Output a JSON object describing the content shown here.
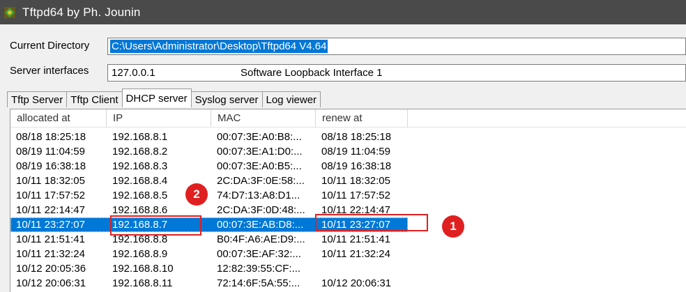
{
  "window": {
    "title": "Tftpd64 by Ph. Jounin",
    "icon": "app-icon"
  },
  "form": {
    "current_directory_label": "Current Directory",
    "current_directory_value": "C:\\Users\\Administrator\\Desktop\\Tftpd64 V4.64",
    "server_interfaces_label": "Server interfaces",
    "server_interface_ip": "127.0.0.1",
    "server_interface_name": "Software Loopback Interface 1"
  },
  "tabs": [
    {
      "label": "Tftp Server"
    },
    {
      "label": "Tftp Client"
    },
    {
      "label": "DHCP server",
      "active": true
    },
    {
      "label": "Syslog server"
    },
    {
      "label": "Log viewer"
    }
  ],
  "table": {
    "columns": [
      "allocated at",
      "IP",
      "MAC",
      "renew at"
    ],
    "rows": [
      [
        "08/18 18:25:18",
        "192.168.8.1",
        "00:07:3E:A0:B8:...",
        "08/18 18:25:18"
      ],
      [
        "08/19 11:04:59",
        "192.168.8.2",
        "00:07:3E:A1:D0:...",
        "08/19 11:04:59"
      ],
      [
        "08/19 16:38:18",
        "192.168.8.3",
        "00:07:3E:A0:B5:...",
        "08/19 16:38:18"
      ],
      [
        "10/11 18:32:05",
        "192.168.8.4",
        "2C:DA:3F:0E:58:...",
        "10/11 18:32:05"
      ],
      [
        "10/11 17:57:52",
        "192.168.8.5",
        "74:D7:13:A8:D1...",
        "10/11 17:57:52"
      ],
      [
        "10/11 22:14:47",
        "192.168.8.6",
        "2C:DA:3F:0D:48:...",
        "10/11 22:14:47"
      ],
      [
        "10/11 23:27:07",
        "192.168.8.7",
        "00:07:3E:AB:D8:...",
        "10/11 23:27:07"
      ],
      [
        "10/11 21:51:41",
        "192.168.8.8",
        "B0:4F:A6:AE:D9:...",
        "10/11 21:51:41"
      ],
      [
        "10/11 21:32:24",
        "192.168.8.9",
        "00:07:3E:AF:32:...",
        "10/11 21:32:24"
      ],
      [
        "10/12 20:05:36",
        "192.168.8.10",
        "12:82:39:55:CF:...",
        ""
      ],
      [
        "10/12 20:06:31",
        "192.168.8.11",
        "72:14:6F:5A:55:...",
        "10/12 20:06:31"
      ]
    ],
    "selected_row": 6
  },
  "annotations": [
    {
      "label": "1",
      "color": "#e02020"
    },
    {
      "label": "2",
      "color": "#e02020"
    }
  ]
}
